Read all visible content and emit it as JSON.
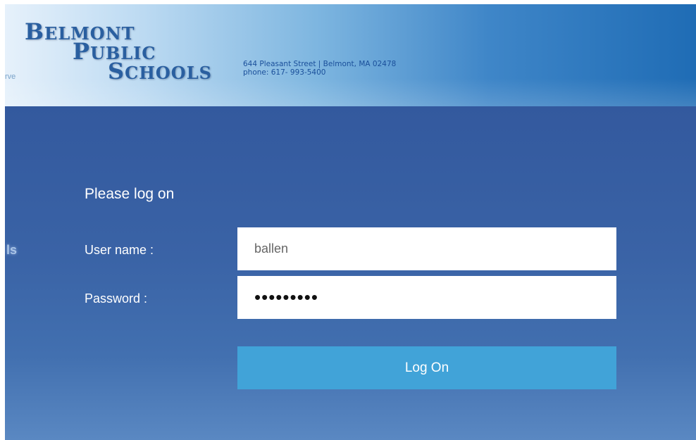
{
  "header": {
    "edge_text": "rve",
    "logo": {
      "line1_initial": "B",
      "line1_rest": "ELMONT",
      "line2_initial": "P",
      "line2_rest": "UBLIC",
      "line3_initial": "S",
      "line3_rest": "CHOOLS"
    },
    "address": "644 Pleasant Street | Belmont, MA 02478",
    "phone": "phone: 617- 993-5400"
  },
  "login": {
    "side_text": "ls",
    "title": "Please log on",
    "username_label": "User name :",
    "username_value": "ballen",
    "password_label": "Password :",
    "password_value": "•••••••••",
    "submit_label": "Log On"
  },
  "colors": {
    "header_gradient_start": "#e6f1fb",
    "header_gradient_end": "#1f6cb5",
    "background": "#3a63a6",
    "logo_text": "#2a5fa0",
    "button": "#41a3d8"
  }
}
